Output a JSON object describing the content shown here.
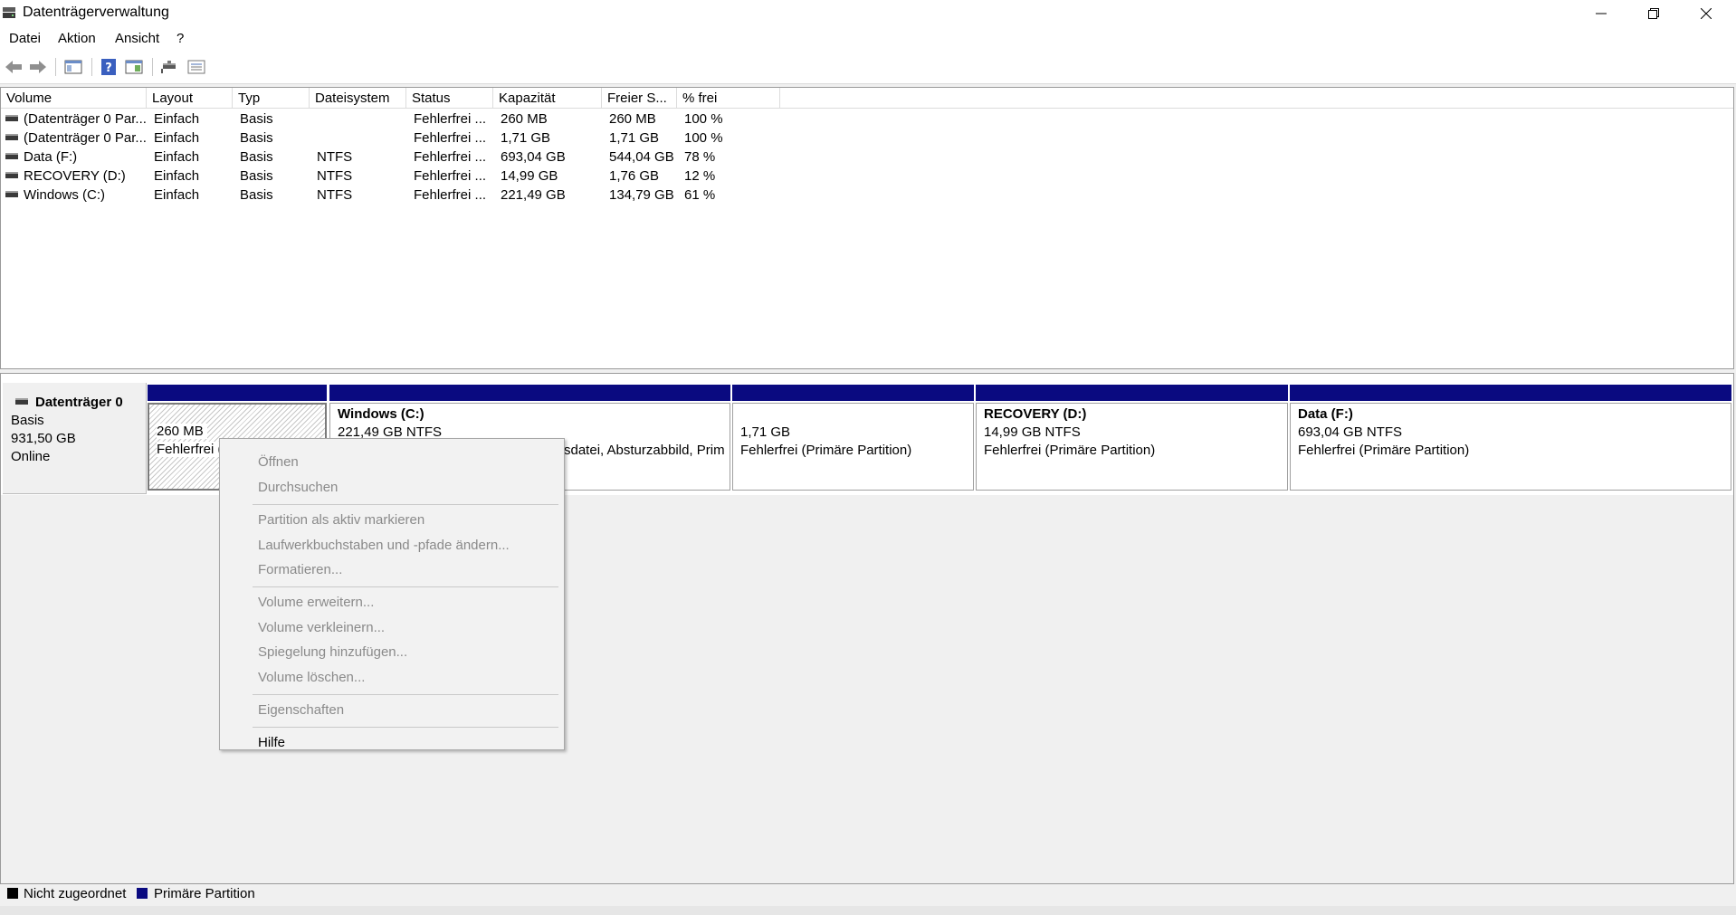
{
  "window": {
    "title": "Datenträgerverwaltung",
    "icon": "disk-management-icon",
    "buttons": [
      "minimize-icon",
      "restore-icon",
      "close-icon"
    ]
  },
  "menubar": {
    "items": [
      "Datei",
      "Aktion",
      "Ansicht",
      "?"
    ]
  },
  "toolbar": {
    "buttons": [
      "back-arrow-icon",
      "forward-arrow-icon",
      "console-tree-icon",
      "help-icon",
      "action-pane-icon",
      "disk-connect-icon",
      "properties-list-icon"
    ]
  },
  "volume_list": {
    "columns": [
      "Volume",
      "Layout",
      "Typ",
      "Dateisystem",
      "Status",
      "Kapazität",
      "Freier S...",
      "% frei"
    ],
    "rows": [
      {
        "volume": "(Datenträger 0 Par...",
        "layout": "Einfach",
        "typ": "Basis",
        "fs": "",
        "status": "Fehlerfrei ...",
        "kapazitaet": "260 MB",
        "frei": "260 MB",
        "prozent": "100 %"
      },
      {
        "volume": "(Datenträger 0 Par...",
        "layout": "Einfach",
        "typ": "Basis",
        "fs": "",
        "status": "Fehlerfrei ...",
        "kapazitaet": "1,71 GB",
        "frei": "1,71 GB",
        "prozent": "100 %"
      },
      {
        "volume": "Data (F:)",
        "layout": "Einfach",
        "typ": "Basis",
        "fs": "NTFS",
        "status": "Fehlerfrei ...",
        "kapazitaet": "693,04 GB",
        "frei": "544,04 GB",
        "prozent": "78 %"
      },
      {
        "volume": "RECOVERY (D:)",
        "layout": "Einfach",
        "typ": "Basis",
        "fs": "NTFS",
        "status": "Fehlerfrei ...",
        "kapazitaet": "14,99 GB",
        "frei": "1,76 GB",
        "prozent": "12 %"
      },
      {
        "volume": "Windows (C:)",
        "layout": "Einfach",
        "typ": "Basis",
        "fs": "NTFS",
        "status": "Fehlerfrei ...",
        "kapazitaet": "221,49 GB",
        "frei": "134,79 GB",
        "prozent": "61 %"
      }
    ]
  },
  "disk": {
    "name": "Datenträger 0",
    "type": "Basis",
    "size": "931,50 GB",
    "state": "Online",
    "partitions": [
      {
        "title": "",
        "size": "260 MB",
        "status": "Fehlerfrei ("
      },
      {
        "title": "Windows  (C:)",
        "size": "221,49 GB NTFS",
        "status": "sdatei, Absturzabbild, Prim"
      },
      {
        "title": "",
        "size": "1,71 GB",
        "status": "Fehlerfrei (Primäre Partition)"
      },
      {
        "title": "RECOVERY  (D:)",
        "size": "14,99 GB NTFS",
        "status": "Fehlerfrei (Primäre Partition)"
      },
      {
        "title": "Data  (F:)",
        "size": "693,04 GB NTFS",
        "status": "Fehlerfrei (Primäre Partition)"
      }
    ]
  },
  "context_menu": {
    "items": [
      "Öffnen",
      "Durchsuchen",
      "Partition als aktiv markieren",
      "Laufwerkbuchstaben und -pfade ändern...",
      "Formatieren...",
      "Volume erweitern...",
      "Volume verkleinern...",
      "Spiegelung hinzufügen...",
      "Volume löschen...",
      "Eigenschaften",
      "Hilfe"
    ]
  },
  "legend": {
    "items": [
      {
        "label": "Nicht zugeordnet",
        "color": "#000000"
      },
      {
        "label": "Primäre Partition",
        "color": "#0a0a80"
      }
    ]
  }
}
